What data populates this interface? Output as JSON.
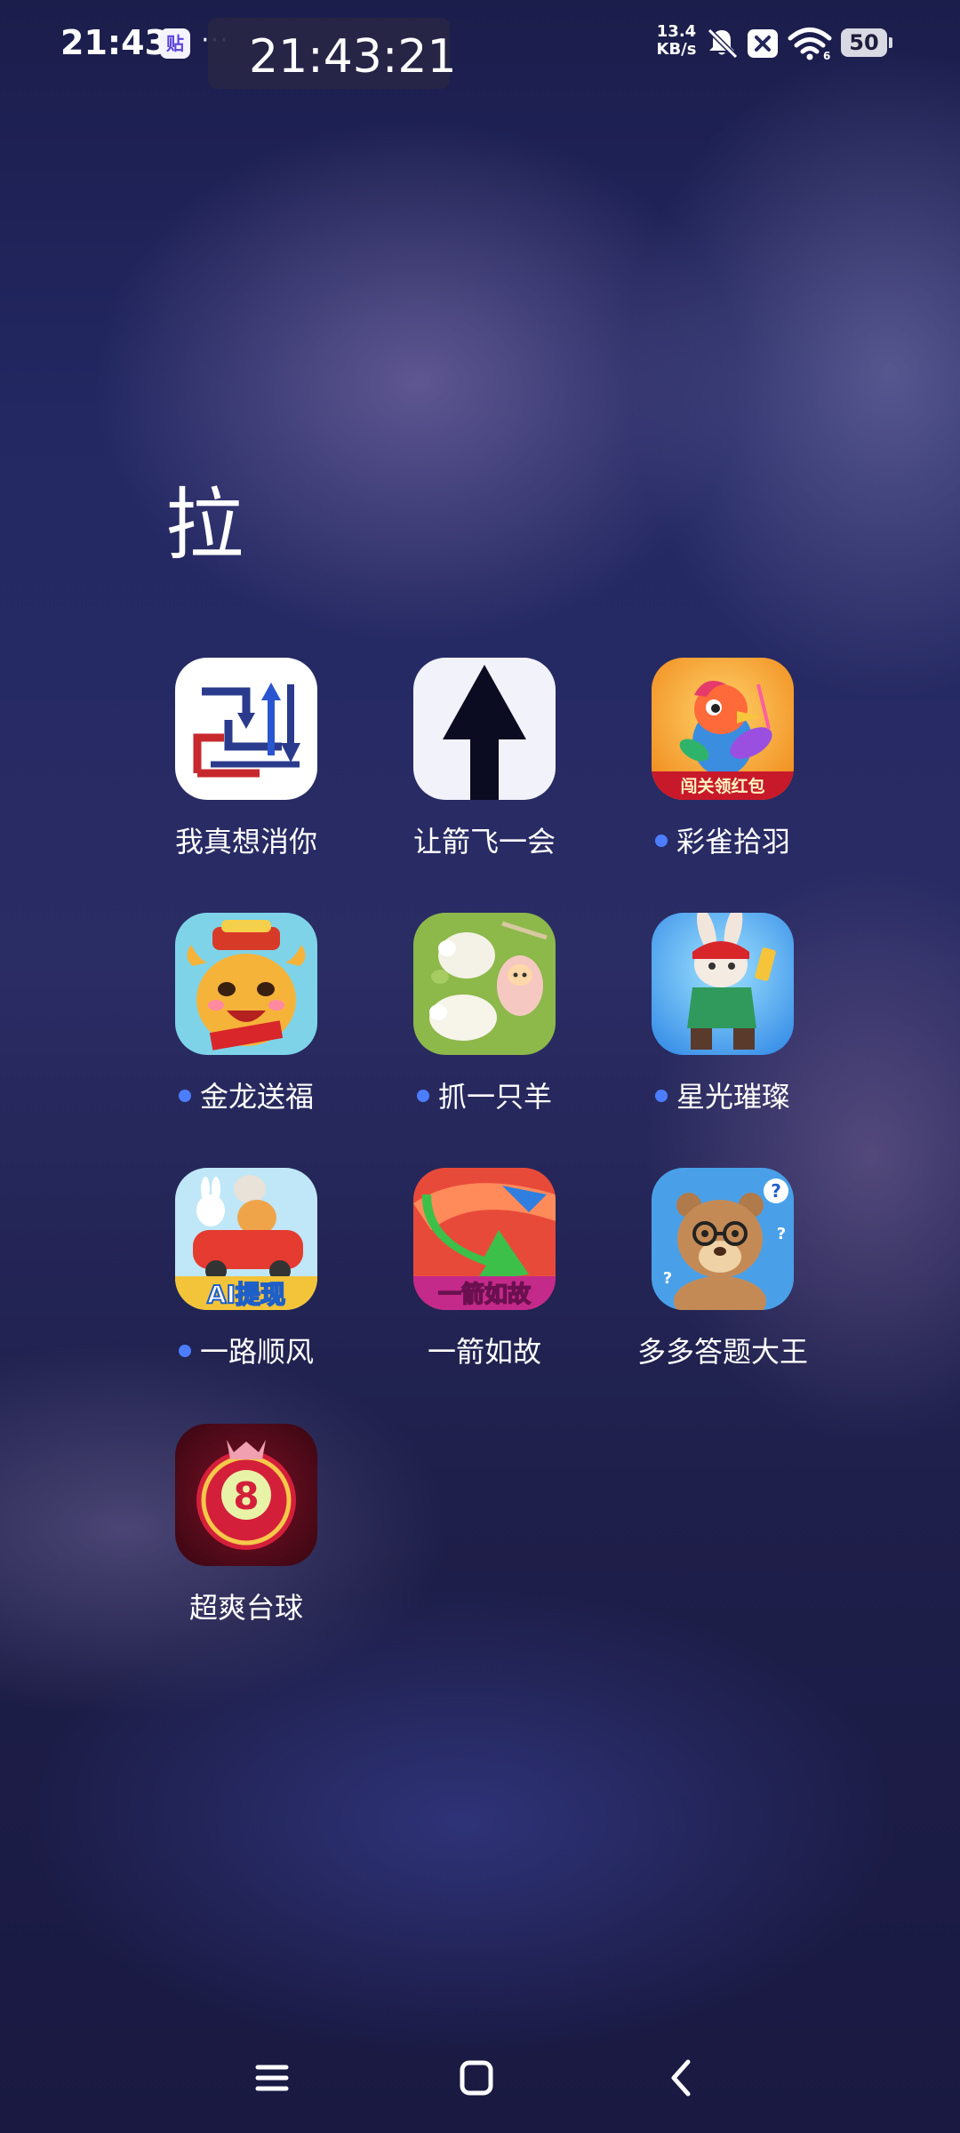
{
  "status_bar": {
    "time": "21:43",
    "app_badge": "贴",
    "more": "···",
    "network_speed_value": "13.4",
    "network_speed_unit": "KB/s",
    "battery": "50"
  },
  "clock_overlay": "21:43:21",
  "folder": {
    "title": "拉",
    "apps": [
      {
        "label": "我真想消你",
        "has_dot": false
      },
      {
        "label": "让箭飞一会",
        "has_dot": false
      },
      {
        "label": "彩雀拾羽",
        "has_dot": true,
        "icon_banner": "闯关领红包"
      },
      {
        "label": "金龙送福",
        "has_dot": true
      },
      {
        "label": "抓一只羊",
        "has_dot": true
      },
      {
        "label": "星光璀璨",
        "has_dot": true
      },
      {
        "label": "一路顺风",
        "has_dot": true,
        "icon_banner": "AI提现"
      },
      {
        "label": "一箭如故",
        "has_dot": false,
        "icon_banner": "一箭如故"
      },
      {
        "label": "多多答题大王",
        "has_dot": false
      },
      {
        "label": "超爽台球",
        "has_dot": false,
        "icon_badge": "8"
      }
    ]
  },
  "colors": {
    "dot": "#4c7dff"
  }
}
